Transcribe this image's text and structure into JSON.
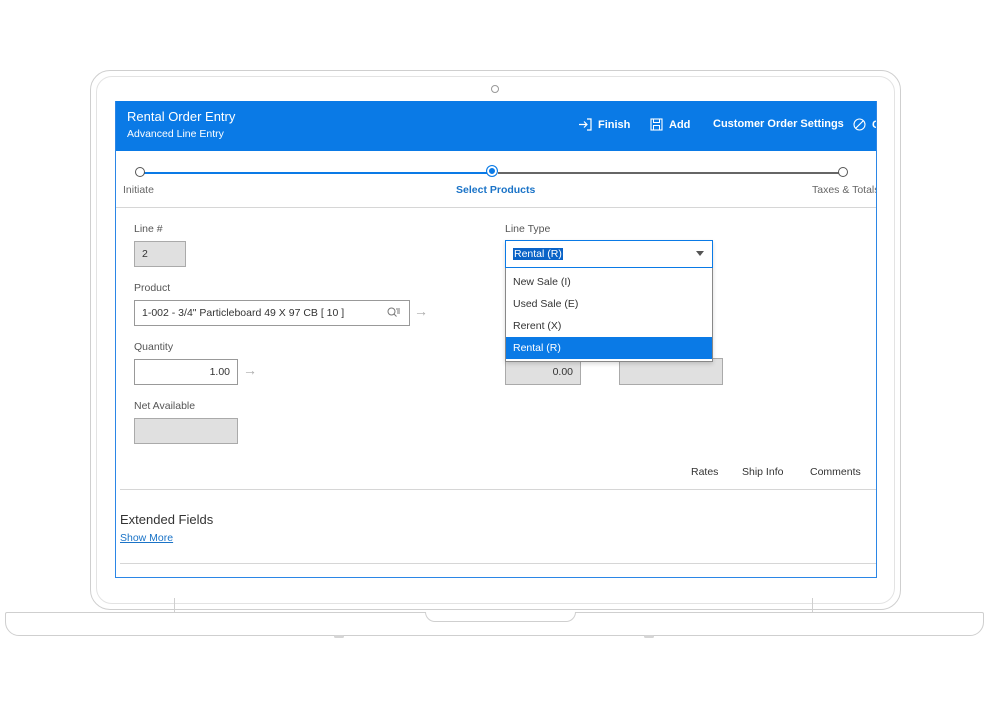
{
  "header": {
    "title": "Rental Order Entry",
    "subtitle": "Advanced Line Entry",
    "actions": [
      {
        "label": "Finish",
        "icon": "finish-icon"
      },
      {
        "label": "Add",
        "icon": "save-icon"
      },
      {
        "label": "Customer Order Settings",
        "icon": ""
      },
      {
        "label": "C",
        "icon": "cancel-icon"
      }
    ]
  },
  "stepper": {
    "steps": [
      "Initiate",
      "Select Products",
      "Taxes & Totals"
    ],
    "active_index": 1
  },
  "form": {
    "line_number_label": "Line #",
    "line_number_value": "2",
    "product_label": "Product",
    "product_value": "1-002 - 3/4\" Particleboard 49 X 97 CB [ 10 ]",
    "quantity_label": "Quantity",
    "quantity_value": "1.00",
    "net_available_label": "Net Available",
    "net_available_value": "",
    "line_type_label": "Line Type",
    "line_type_value": "Rental (R)",
    "line_type_options": [
      "New Sale (I)",
      "Used Sale (E)",
      "Rerent (X)",
      "Rental (R)"
    ],
    "line_type_selected_index": 3,
    "hidden_field_value": "0.00",
    "hidden_field2_value": ""
  },
  "tabs": [
    "Rates",
    "Ship Info",
    "Comments"
  ],
  "extended": {
    "title": "Extended Fields",
    "show_more": "Show More"
  },
  "colors": {
    "brand": "#0a7ae6",
    "selected_option": "#0a7ae6"
  }
}
